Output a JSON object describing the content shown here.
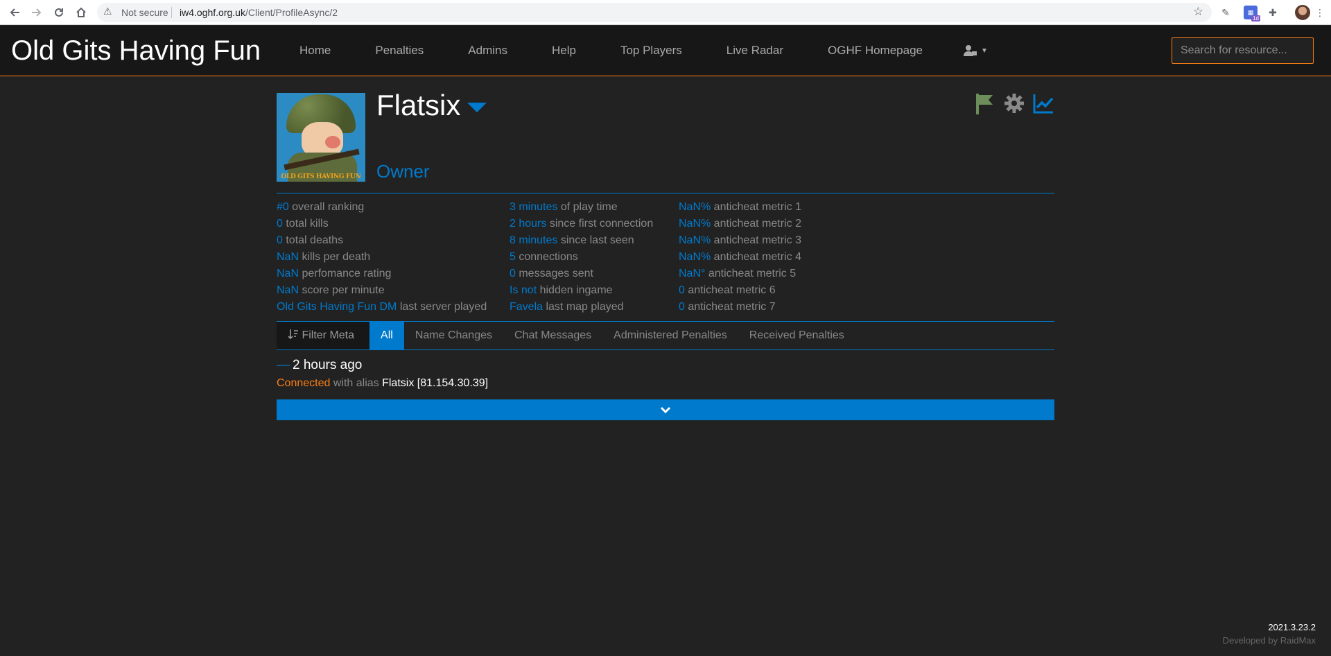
{
  "browser": {
    "security_label": "Not secure",
    "url_host": "iw4.oghf.org.uk",
    "url_path": "/Client/ProfileAsync/2",
    "extension_badge": "1d"
  },
  "navbar": {
    "brand": "Old Gits Having Fun",
    "links": [
      "Home",
      "Penalties",
      "Admins",
      "Help",
      "Top Players",
      "Live Radar",
      "OGHF Homepage"
    ],
    "search_placeholder": "Search for resource..."
  },
  "profile": {
    "avatar_caption": "OLD GITS HAVING FUN",
    "name": "Flatsix",
    "level": "Owner",
    "accent_color": "#007acc",
    "stats_col1": [
      {
        "value": "#0",
        "label": " overall ranking"
      },
      {
        "value": "0",
        "label": " total kills"
      },
      {
        "value": "0",
        "label": " total deaths"
      },
      {
        "value": "NaN",
        "label": " kills per death"
      },
      {
        "value": "NaN",
        "label": " perfomance rating"
      },
      {
        "value": "NaN",
        "label": " score per minute"
      },
      {
        "value": "Old Gits Having Fun DM",
        "label": " last server played"
      }
    ],
    "stats_col2": [
      {
        "value": "3 minutes",
        "label": " of play time"
      },
      {
        "value": "2 hours",
        "label": " since first connection"
      },
      {
        "value": "8 minutes",
        "label": " since last seen"
      },
      {
        "value": "5",
        "label": " connections"
      },
      {
        "value": "0",
        "label": " messages sent"
      },
      {
        "value": "Is not",
        "label": " hidden ingame"
      },
      {
        "value": "Favela",
        "label": " last map played"
      }
    ],
    "stats_col3": [
      {
        "value": "NaN%",
        "label": " anticheat metric 1"
      },
      {
        "value": "NaN%",
        "label": " anticheat metric 2"
      },
      {
        "value": "NaN%",
        "label": " anticheat metric 3"
      },
      {
        "value": "NaN%",
        "label": " anticheat metric 4"
      },
      {
        "value": "NaN°",
        "label": " anticheat metric 5"
      },
      {
        "value": "0",
        "label": " anticheat metric 6"
      },
      {
        "value": "0",
        "label": " anticheat metric 7"
      }
    ]
  },
  "tabs": {
    "filter": "Filter Meta",
    "items": [
      "All",
      "Name Changes",
      "Chat Messages",
      "Administered Penalties",
      "Received Penalties"
    ],
    "active": "All"
  },
  "events": [
    {
      "dash": "—",
      "time": "2 hours ago",
      "keyword": "Connected",
      "text": " with alias ",
      "alias": "Flatsix [81.154.30.39]"
    }
  ],
  "footer": {
    "version": "2021.3.23.2",
    "developer": "Developed by RaidMax"
  }
}
